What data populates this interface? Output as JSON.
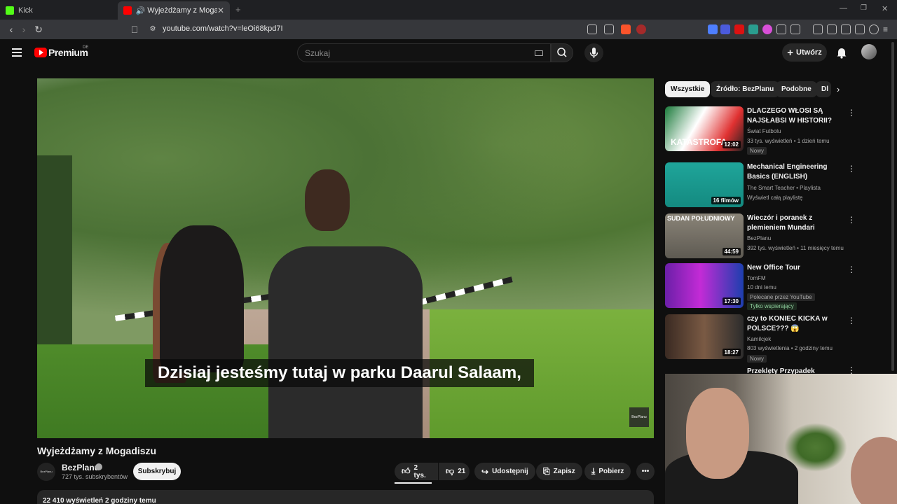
{
  "browser": {
    "tabs": [
      {
        "label": "Kick",
        "active": false
      },
      {
        "label": "Wyjeżdżamy z Mogadiszu - Y",
        "active": true
      }
    ],
    "new_tab": "+",
    "url": "youtube.com/watch?v=leOi68kpd7I"
  },
  "header": {
    "brand": "Premium",
    "country_code": "DE",
    "search_placeholder": "Szukaj",
    "create_label": "Utwórz"
  },
  "video": {
    "subtitle": "Dzisiaj jesteśmy tutaj w parku Daarul Salaam,",
    "watermark": "BezPlanu",
    "title": "Wyjeżdżamy z Mogadiszu",
    "channel": "BezPlanu",
    "subscribers": "727 tys. subskrybentów",
    "subscribe_label": "Subskrybuj",
    "likes": "2 tys.",
    "dislikes": "21",
    "share_label": "Udostępnij",
    "save_label": "Zapisz",
    "download_label": "Pobierz",
    "description_stats": "22 410 wyświetleń  2 godziny temu"
  },
  "sidebar": {
    "chips": [
      {
        "label": "Wszystkie",
        "active": true
      },
      {
        "label": "Źródło: BezPlanu",
        "active": false
      },
      {
        "label": "Podobne",
        "active": false
      },
      {
        "label": "Dl",
        "active": false
      }
    ],
    "items": [
      {
        "title": "DLACZEGO WŁOSI SĄ NAJSŁABSI W HISTORII?",
        "channel": "Świat Futbolu",
        "meta": "33 tys. wyświetleń • 1 dzień temu",
        "badge": "Nowy",
        "duration": "12:02",
        "thumb_text": "KATASTROFA"
      },
      {
        "title": "Mechanical Engineering Basics (ENGLISH)",
        "channel": "The Smart Teacher • Playlista",
        "meta": "Wyświetl całą playlistę",
        "duration": "16 filmów"
      },
      {
        "title": "Wieczór i poranek z plemieniem Mundari",
        "channel": "BezPlanu",
        "meta": "392 tys. wyświetleń • 11 miesięcy temu",
        "duration": "44:59",
        "thumb_text": "SUDAN POŁUDNIOWY"
      },
      {
        "title": "New Office Tour",
        "channel": "TomFM",
        "meta": "10 dni temu",
        "badge": "Polecane przez YouTube",
        "green": "Tylko wspierający",
        "duration": "17:30"
      },
      {
        "title": "czy to KONIEC KICKA w POLSCE??? 😱",
        "channel": "Kamilcjek",
        "meta": "803 wyświetlenia • 2 godziny temu",
        "badge": "Nowy",
        "duration": "18:27"
      },
      {
        "title": "Przeklęty Przypadek Jaszczura"
      }
    ]
  },
  "colors": {
    "background": "#0f0f0f",
    "youtube_red": "#ff0000",
    "chip_bg": "#272727",
    "text": "#f1f1f1",
    "secondary_text": "#aaaaaa"
  }
}
